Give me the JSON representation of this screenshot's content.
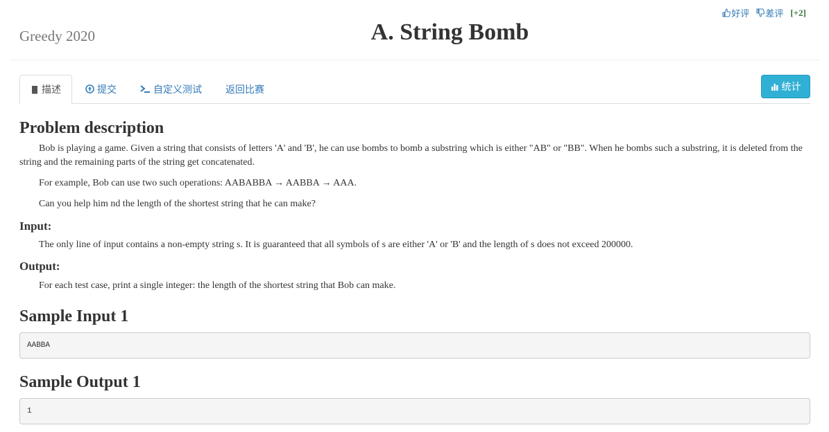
{
  "vote": {
    "like_label": "好评",
    "dislike_label": "差评",
    "score": "[+2]"
  },
  "header": {
    "contest_name": "Greedy 2020",
    "problem_title": "A. String Bomb"
  },
  "tabs": [
    {
      "label": "描述",
      "icon": "book-icon",
      "active": true
    },
    {
      "label": "提交",
      "icon": "upload-circle-icon",
      "active": false
    },
    {
      "label": "自定义测试",
      "icon": "terminal-icon",
      "active": false
    },
    {
      "label": "返回比赛",
      "icon": "",
      "active": false
    }
  ],
  "stat_button": {
    "label": "统计",
    "icon": "bar-chart-icon"
  },
  "problem": {
    "description_title": "Problem description",
    "description_p1": "Bob is playing a game. Given a string that consists of letters 'A' and 'B', he can use bombs to bomb a substring which is either \"AB\" or \"BB\". When he bombs such a substring, it is deleted from the string and the remaining parts of the string get concatenated.",
    "description_p2": "For example, Bob can use two such operations: AABABBA → AABBA → AAA.",
    "description_p3": "Can you help him nd the length of the shortest string that he can make?",
    "input_title": "Input:",
    "input_text": "The only line of input contains a non-empty string s. It is guaranteed that all symbols of s are either 'A' or 'B' and the length of s does not exceed 200000.",
    "output_title": "Output:",
    "output_text": "For each test case, print a single integer: the length of the shortest string that Bob can make.",
    "sample_input_title": "Sample Input 1",
    "sample_input": "AABBA",
    "sample_output_title": "Sample Output 1",
    "sample_output": "1"
  },
  "colors": {
    "link": "#337ab7",
    "info_button": "#31b0d5",
    "score_green": "#3c763d"
  }
}
